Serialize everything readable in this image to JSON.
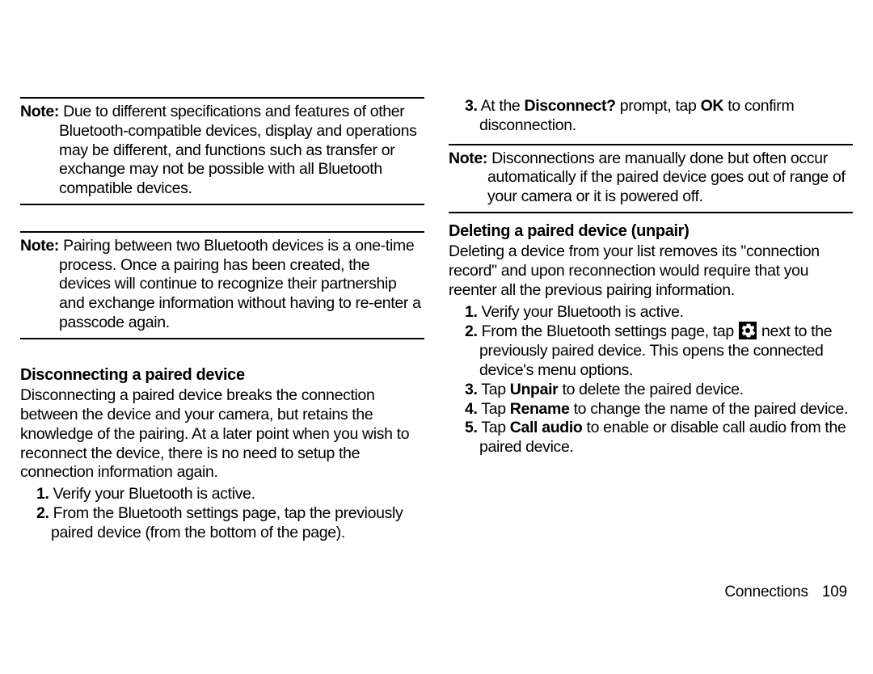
{
  "left": {
    "note1_label": "Note:",
    "note1_body": "Due to different specifications and features of other Bluetooth-compatible devices, display and operations may be different, and functions such as transfer or exchange may not be possible with all Bluetooth compatible devices.",
    "note2_label": "Note:",
    "note2_body": "Pairing between two Bluetooth devices is a one-time process. Once a pairing has been created, the devices will continue to recognize their partnership and exchange information without having to re-enter a passcode again.",
    "heading1": "Disconnecting a paired device",
    "para1": "Disconnecting a paired device breaks the connection between the device and your camera, but retains the knowledge of the pairing. At a later point when you wish to reconnect the device, there is no need to setup the connection information again.",
    "step1_num": "1.",
    "step1": "Verify your Bluetooth is active.",
    "step2_num": "2.",
    "step2": "From the Bluetooth settings page, tap the previously paired device (from the bottom of the page)."
  },
  "right": {
    "step3_num": "3.",
    "step3_a": "At the ",
    "step3_bold1": "Disconnect?",
    "step3_b": " prompt, tap ",
    "step3_bold2": "OK",
    "step3_c": " to confirm disconnection.",
    "note3_label": "Note:",
    "note3_body": "Disconnections are manually done but often occur automatically if the paired device goes out of range of your camera or it is powered off.",
    "heading2": "Deleting a paired device (unpair)",
    "para2": "Deleting a device from your list removes its \"connection record\" and upon reconnection would require that you reenter all the previous pairing information.",
    "d_step1_num": "1.",
    "d_step1": "Verify your Bluetooth is active.",
    "d_step2_num": "2.",
    "d_step2_a": "From the Bluetooth settings page, tap ",
    "d_step2_b": " next to the previously paired device. This opens the connected device's menu options.",
    "d_step3_num": "3.",
    "d_step3_a": "Tap ",
    "d_step3_bold": "Unpair",
    "d_step3_b": " to delete the paired device.",
    "d_step4_num": "4.",
    "d_step4_a": "Tap ",
    "d_step4_bold": "Rename",
    "d_step4_b": " to change the name of the paired device.",
    "d_step5_num": "5.",
    "d_step5_a": "Tap ",
    "d_step5_bold": "Call audio",
    "d_step5_b": " to enable or disable call audio from the paired device."
  },
  "footer": {
    "section": "Connections",
    "page": "109"
  }
}
